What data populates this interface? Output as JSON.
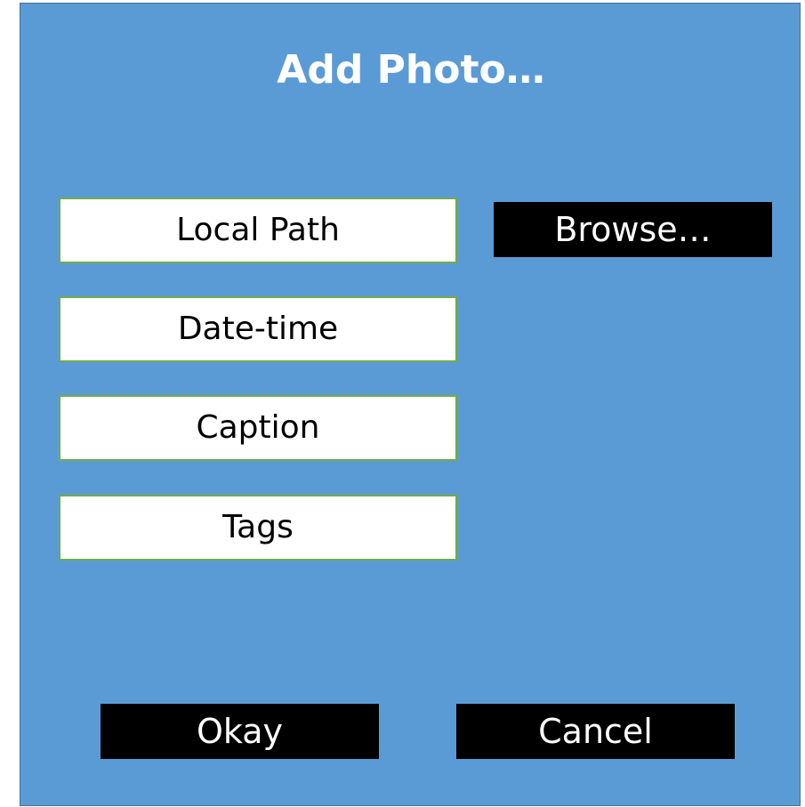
{
  "dialog": {
    "title": "Add Photo…",
    "fields": [
      {
        "label": "Local Path"
      },
      {
        "label": "Date-time"
      },
      {
        "label": "Caption"
      },
      {
        "label": "Tags"
      }
    ],
    "browse_label": "Browse…",
    "okay_label": "Okay",
    "cancel_label": "Cancel"
  },
  "colors": {
    "dialog_background": "#5b9bd5",
    "field_border": "#70ad47",
    "button_background": "#000000",
    "button_text": "#ffffff"
  }
}
